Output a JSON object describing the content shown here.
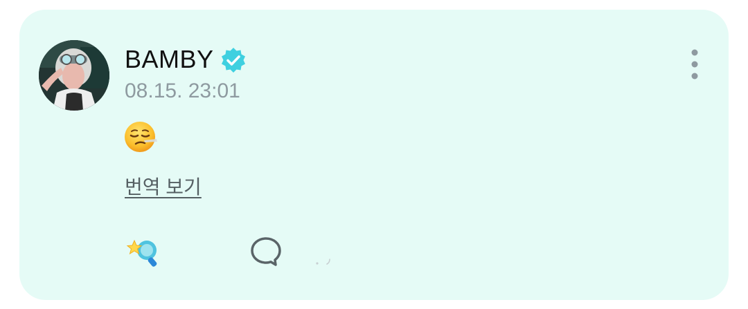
{
  "post": {
    "author": "BAMBY",
    "verified": true,
    "timestamp": "08.15. 23:01",
    "content_emoji": "relieved-face",
    "translate_link": "번역 보기"
  },
  "icons": {
    "verified_badge": "verified-check-icon",
    "more": "more-vertical-icon",
    "reaction": "star-lightstick-icon",
    "comment": "speech-bubble-icon"
  },
  "colors": {
    "card_background": "#e5fbf6",
    "verified": "#3fd0e0",
    "muted_text": "#8e9aa0"
  }
}
